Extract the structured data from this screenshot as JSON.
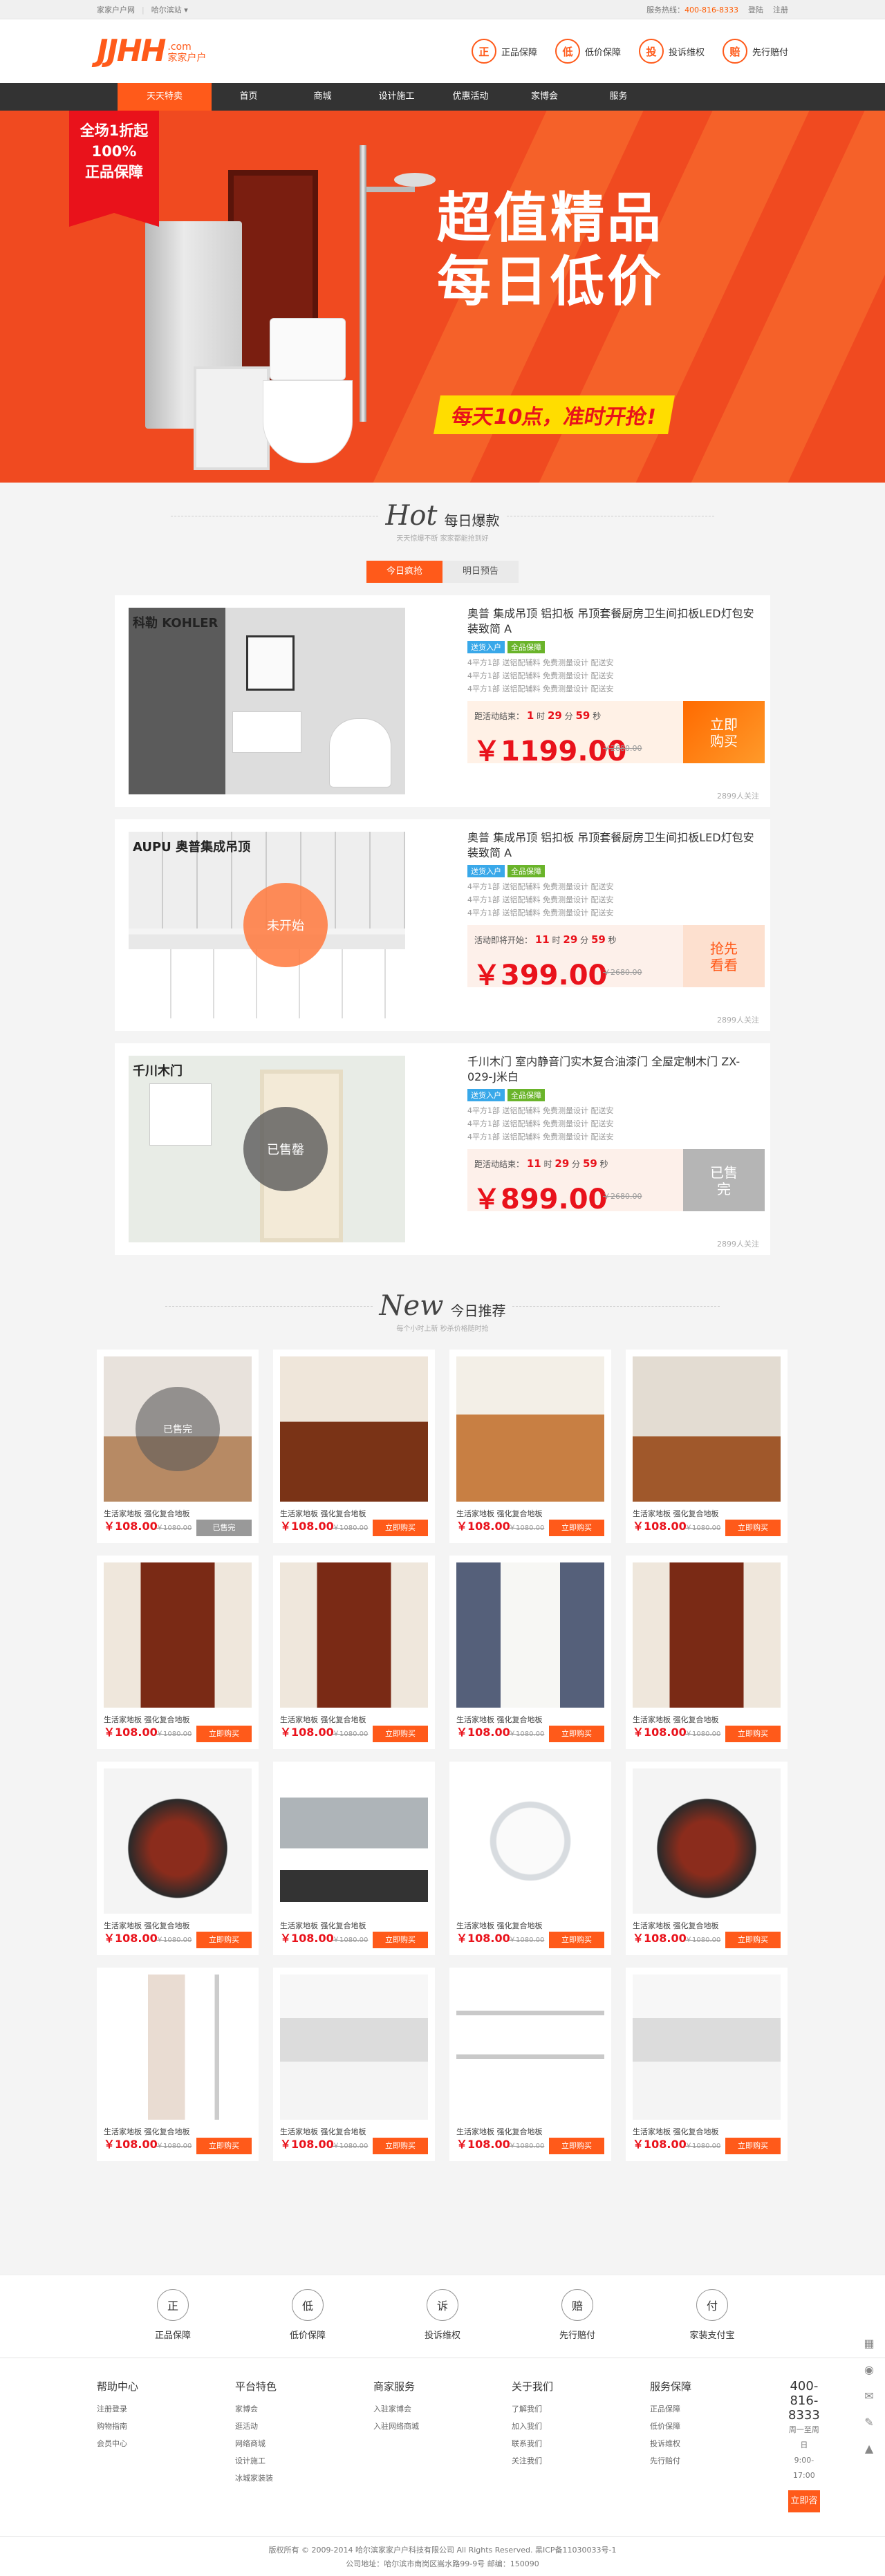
{
  "topbar": {
    "site": "家家户户网",
    "city": "哈尔滨站",
    "hotline_label": "服务热线：",
    "hotline": "400-816-8333",
    "login": "登陆",
    "register": "注册"
  },
  "logo": {
    "text": "JJHH",
    "dotcom": ".com",
    "cn": "家家户户"
  },
  "guarantees": [
    {
      "icon": "正",
      "label": "正品保障"
    },
    {
      "icon": "低",
      "label": "低价保障"
    },
    {
      "icon": "投",
      "label": "投诉维权"
    },
    {
      "icon": "赔",
      "label": "先行赔付"
    }
  ],
  "nav": [
    "天天特卖",
    "首页",
    "商城",
    "设计施工",
    "优惠活动",
    "家博会",
    "服务"
  ],
  "banner": {
    "badge": [
      "全场1折起",
      "100%",
      "正品保障"
    ],
    "title1": "超值精品",
    "title2": "每日低价",
    "slogan": "每天10点，准时开抢!"
  },
  "hot": {
    "en": "Hot",
    "cn": "每日爆款",
    "sub": "天天惊爆不断  家家都能抢到好",
    "tab_today": "今日疯抢",
    "tab_tomorrow": "明日预告"
  },
  "deals": [
    {
      "brand": "科勒 KOHLER",
      "title": "奥普 集成吊顶 铝扣板 吊顶套餐厨房卫生间扣板LED灯包安装致简 A",
      "tags": [
        "送货入户",
        "全品保障"
      ],
      "features": [
        "4平方1部 送铝配辅料 免费测量设计 配送安",
        "4平方1部 送铝配辅料 免费测量设计 配送安",
        "4平方1部 送铝配辅料 免费测量设计 配送安"
      ],
      "cd_label": "距活动结束：",
      "days": "1",
      "hours": "29",
      "mins": "59",
      "d": "时",
      "m": "分",
      "s": "秒",
      "price": "￥1199.00",
      "old": "￥2680.00",
      "btn": "立即购买",
      "follow": "2899人关注",
      "status": ""
    },
    {
      "brand": "AUPU 奥普集成吊顶",
      "title": "奥普 集成吊顶 铝扣板 吊顶套餐厨房卫生间扣板LED灯包安装致简 A",
      "tags": [
        "送货入户",
        "全品保障"
      ],
      "features": [
        "4平方1部 送铝配辅料 免费测量设计 配送安",
        "4平方1部 送铝配辅料 免费测量设计 配送安",
        "4平方1部 送铝配辅料 免费测量设计 配送安"
      ],
      "cd_label": "活动即将开始：",
      "days": "11",
      "hours": "29",
      "mins": "59",
      "d": "时",
      "m": "分",
      "s": "秒",
      "price": "￥399.00",
      "old": "￥2680.00",
      "btn": "抢先看看",
      "follow": "2899人关注",
      "status": "未开始"
    },
    {
      "brand": "千川木门",
      "title": "千川木门 室内静音门实木复合油漆门 全屋定制木门 ZX-029-J米白",
      "tags": [
        "送货入户",
        "全品保障"
      ],
      "features": [
        "4平方1部 送铝配辅料 免费测量设计 配送安",
        "4平方1部 送铝配辅料 免费测量设计 配送安",
        "4平方1部 送铝配辅料 免费测量设计 配送安"
      ],
      "cd_label": "距活动结束：",
      "days": "11",
      "hours": "29",
      "mins": "59",
      "d": "时",
      "m": "分",
      "s": "秒",
      "price": "￥899.00",
      "old": "￥2680.00",
      "btn": "已售完",
      "follow": "2899人关注",
      "status": "已售罄"
    }
  ],
  "new": {
    "en": "New",
    "cn": "今日推荐",
    "sub": "每个小时上新  秒杀价格随时抢"
  },
  "products": [
    {
      "name": "生活家地板 强化复合地板",
      "price": "￥108.00",
      "old": "￥1080.00",
      "btn": "已售完",
      "soldout": true,
      "kind": "floor1"
    },
    {
      "name": "生活家地板 强化复合地板",
      "price": "￥108.00",
      "old": "￥1080.00",
      "btn": "立即购买",
      "kind": "floor2"
    },
    {
      "name": "生活家地板 强化复合地板",
      "price": "￥108.00",
      "old": "￥1080.00",
      "btn": "立即购买",
      "kind": "floor3"
    },
    {
      "name": "生活家地板 强化复合地板",
      "price": "￥108.00",
      "old": "￥1080.00",
      "btn": "立即购买",
      "kind": "floor4"
    },
    {
      "name": "生活家地板 强化复合地板",
      "price": "￥108.00",
      "old": "￥1080.00",
      "btn": "立即购买",
      "kind": "door"
    },
    {
      "name": "生活家地板 强化复合地板",
      "price": "￥108.00",
      "old": "￥1080.00",
      "btn": "立即购买",
      "kind": "door"
    },
    {
      "name": "生活家地板 强化复合地板",
      "price": "￥108.00",
      "old": "￥1080.00",
      "btn": "立即购买",
      "kind": "doorw"
    },
    {
      "name": "生活家地板 强化复合地板",
      "price": "￥108.00",
      "old": "￥1080.00",
      "btn": "立即购买",
      "kind": "door"
    },
    {
      "name": "生活家地板 强化复合地板",
      "price": "￥108.00",
      "old": "￥1080.00",
      "btn": "立即购买",
      "kind": "tv"
    },
    {
      "name": "生活家地板 强化复合地板",
      "price": "￥108.00",
      "old": "￥1080.00",
      "btn": "立即购买",
      "kind": "hood"
    },
    {
      "name": "生活家地板 强化复合地板",
      "price": "￥108.00",
      "old": "￥1080.00",
      "btn": "立即购买",
      "kind": "heater"
    },
    {
      "name": "生活家地板 强化复合地板",
      "price": "￥108.00",
      "old": "￥1080.00",
      "btn": "立即购买",
      "kind": "tv"
    },
    {
      "name": "生活家地板 强化复合地板",
      "price": "￥108.00",
      "old": "￥1080.00",
      "btn": "立即购买",
      "kind": "shower"
    },
    {
      "name": "生活家地板 强化复合地板",
      "price": "￥108.00",
      "old": "￥1080.00",
      "btn": "立即购买",
      "kind": "ceiling"
    },
    {
      "name": "生活家地板 强化复合地板",
      "price": "￥108.00",
      "old": "￥1080.00",
      "btn": "立即购买",
      "kind": "rack"
    },
    {
      "name": "生活家地板 强化复合地板",
      "price": "￥108.00",
      "old": "￥1080.00",
      "btn": "立即购买",
      "kind": "ceiling"
    }
  ],
  "services": [
    {
      "icon": "正",
      "label": "正品保障"
    },
    {
      "icon": "低",
      "label": "低价保障"
    },
    {
      "icon": "诉",
      "label": "投诉维权"
    },
    {
      "icon": "赔",
      "label": "先行赔付"
    },
    {
      "icon": "付",
      "label": "家装支付宝"
    }
  ],
  "footer": {
    "cols": [
      {
        "title": "帮助中心",
        "items": [
          "注册登录",
          "购物指南",
          "会员中心"
        ]
      },
      {
        "title": "平台特色",
        "items": [
          "家博会",
          "逛活动",
          "网络商城",
          "设计施工",
          "冰城家装装"
        ]
      },
      {
        "title": "商家服务",
        "items": [
          "入驻家博会",
          "入驻网络商城"
        ]
      },
      {
        "title": "关于我们",
        "items": [
          "了解我们",
          "加入我们",
          "联系我们",
          "关注我们"
        ]
      },
      {
        "title": "服务保障",
        "items": [
          "正品保障",
          "低价保障",
          "投诉维权",
          "先行赔付"
        ]
      }
    ],
    "tel": "400-816-8333",
    "hours1": "周一至周日",
    "hours2": "9:00-17:00",
    "consult": "立即咨询"
  },
  "copyright": "版权所有 © 2009-2014 哈尔滨家家户户科技有限公司 All Rights Reserved.  黑ICP备11030033号-1",
  "address": "公司地址：哈尔滨市南岗区嵩水路99-9号  邮编：150090",
  "colors": {
    "accent": "#ff5a1a",
    "price": "#e9121b",
    "nav": "#333333"
  }
}
